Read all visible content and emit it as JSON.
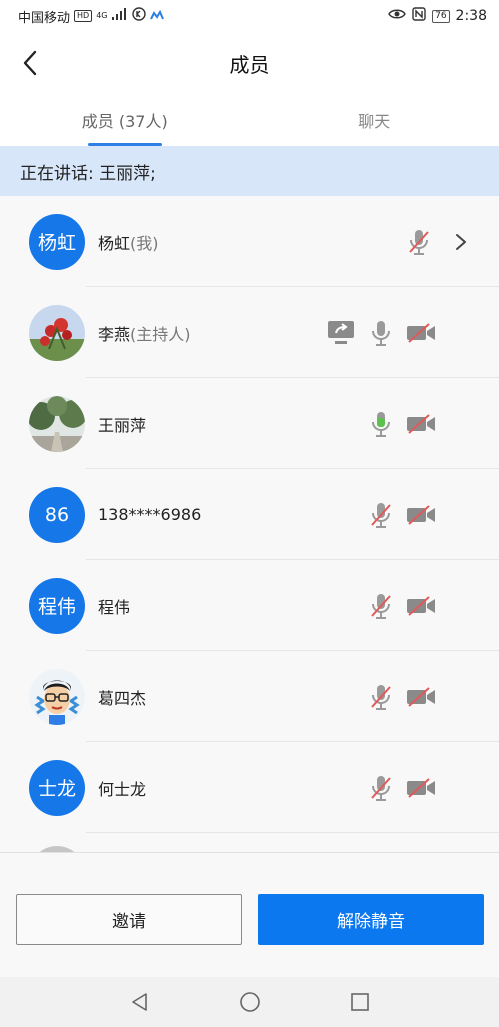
{
  "status_bar": {
    "carrier": "中国移动",
    "network_badge": "HD",
    "signal_text": "4G",
    "battery_level": "76",
    "time": "2:38"
  },
  "header": {
    "title": "成员",
    "back_icon": "chevron-left-icon"
  },
  "tabs": [
    {
      "label": "成员 (37人)",
      "active": true
    },
    {
      "label": "聊天",
      "active": false
    }
  ],
  "speaking_banner": "正在讲话: 王丽萍;",
  "members": [
    {
      "name": "杨虹",
      "tag": "(我)",
      "avatar_text": "杨虹",
      "avatar_type": "text",
      "share": false,
      "mic": "muted",
      "camera": "none",
      "arrow": true
    },
    {
      "name": "李燕",
      "tag": "(主持人)",
      "avatar_text": "",
      "avatar_type": "photo-flower",
      "share": true,
      "mic": "on",
      "camera": "off",
      "arrow": false
    },
    {
      "name": "王丽萍",
      "tag": "",
      "avatar_text": "",
      "avatar_type": "photo-trees",
      "share": false,
      "mic": "speaking",
      "camera": "off",
      "arrow": false
    },
    {
      "name": "138****6986",
      "tag": "",
      "avatar_text": "86",
      "avatar_type": "text",
      "share": false,
      "mic": "muted",
      "camera": "off",
      "arrow": false
    },
    {
      "name": "程伟",
      "tag": "",
      "avatar_text": "程伟",
      "avatar_type": "text",
      "share": false,
      "mic": "muted",
      "camera": "off",
      "arrow": false
    },
    {
      "name": "葛四杰",
      "tag": "",
      "avatar_text": "",
      "avatar_type": "cartoon",
      "share": false,
      "mic": "muted",
      "camera": "off",
      "arrow": false
    },
    {
      "name": "何士龙",
      "tag": "",
      "avatar_text": "士龙",
      "avatar_type": "text",
      "share": false,
      "mic": "muted",
      "camera": "off",
      "arrow": false
    }
  ],
  "buttons": {
    "invite": "邀请",
    "unmute": "解除静音"
  },
  "colors": {
    "accent": "#0b78f0",
    "avatar_blue": "#1677e8",
    "speaking_green": "#5ac34a",
    "muted_red": "#e05a5a",
    "banner_bg": "#d7e7f9"
  }
}
